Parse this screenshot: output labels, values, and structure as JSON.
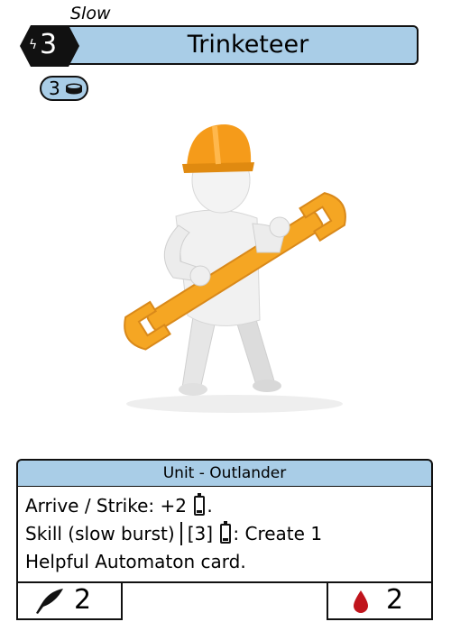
{
  "card": {
    "speed": "Slow",
    "cost": "3",
    "name": "Trinketeer",
    "resource_cost": "3",
    "type_line": "Unit - Outlander",
    "rules": {
      "line1_prefix": "Arrive / Strike: +2",
      "line1_suffix": ".",
      "line2_prefix": "Skill (slow burst)",
      "line2_cost": "[3]",
      "line2_suffix": ": Create 1",
      "line3": "Helpful Automaton card."
    },
    "power": "2",
    "health": "2"
  },
  "colors": {
    "banner": "#a9cde7",
    "cost_hex": "#111111",
    "health_drop": "#c0141c",
    "wrench": "#f5a623",
    "hardhat": "#f59b1a"
  },
  "icons": {
    "cost": "bolt-icon",
    "resource": "coin-stack-icon",
    "energy": "battery-icon",
    "power": "feather-quill-icon",
    "health": "blood-drop-icon"
  }
}
